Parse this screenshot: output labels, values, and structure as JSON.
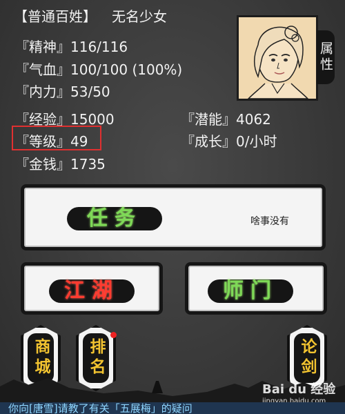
{
  "header": {
    "identity": "【普通百姓】",
    "name": "无名少女"
  },
  "stats": {
    "spirit_label": "『精神』",
    "spirit_value": "116/116",
    "blood_label": "『气血』",
    "blood_value": "100/100 (100%)",
    "inner_label": "『内力』",
    "inner_value": "53/50",
    "exp_label": "『经验』",
    "exp_value": "15000",
    "potential_label": "『潜能』",
    "potential_value": "4062",
    "level_label": "『等级』",
    "level_value": "49",
    "growth_label": "『成长』",
    "growth_value": "0/小时",
    "money_label": "『金钱』",
    "money_value": "1735"
  },
  "attr_tab": "属性",
  "buttons": {
    "quest": "任务",
    "quest_status": "啥事没有",
    "jianghu": "江湖",
    "sect": "师门",
    "shop": "商城",
    "rank": "排名",
    "forum": "论剑"
  },
  "message": "你向[唐雪]请教了有关「五展梅」的疑问",
  "watermark": {
    "brand": "Bai du 经验",
    "url": "jingyan.baidu.com"
  },
  "colors": {
    "green": "#7ed957",
    "red": "#ff3b30",
    "gold": "#f3c430",
    "highlight": "#e03030"
  }
}
